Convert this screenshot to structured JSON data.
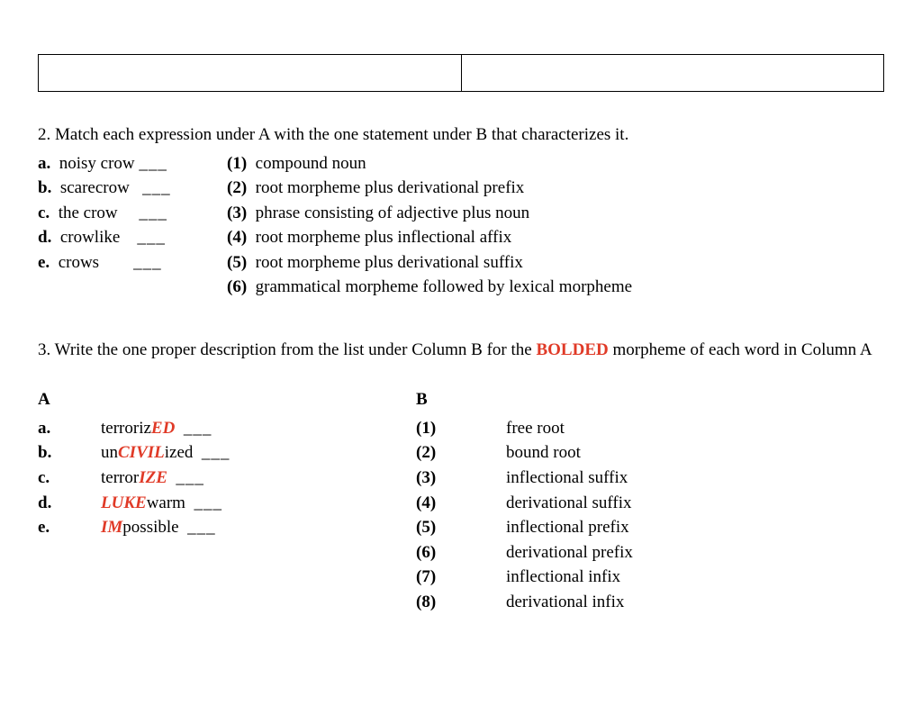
{
  "q2": {
    "prompt": "2. Match each expression under A with the one statement under B that characterizes it.",
    "leftItems": [
      {
        "marker": "a.",
        "text": "noisy crow"
      },
      {
        "marker": "b.",
        "text": "scarecrow"
      },
      {
        "marker": "c.",
        "text": "the crow"
      },
      {
        "marker": "d.",
        "text": "crowlike"
      },
      {
        "marker": "e.",
        "text": "crows"
      }
    ],
    "rightItems": [
      {
        "marker": "(1)",
        "text": "compound noun"
      },
      {
        "marker": "(2)",
        "text": "root morpheme plus derivational prefix"
      },
      {
        "marker": "(3)",
        "text": "phrase consisting of adjective plus noun"
      },
      {
        "marker": "(4)",
        "text": "root morpheme plus inflectional affix"
      },
      {
        "marker": "(5)",
        "text": "root morpheme plus derivational suffix"
      },
      {
        "marker": "(6)",
        "text": "grammatical morpheme followed by lexical morpheme"
      }
    ],
    "blank": "___"
  },
  "q3": {
    "prompt_pre": "3. Write the one proper description from the list under Column B for the ",
    "prompt_bold": "BOLDED",
    "prompt_post": " morpheme of each word in Column A",
    "colA_head": "A",
    "colB_head": "B",
    "A_items": [
      {
        "marker": "a.",
        "pre": "terroriz",
        "bold": "ED",
        "post": ""
      },
      {
        "marker": "b.",
        "pre": "un",
        "bold": "CIVIL",
        "post": "ized"
      },
      {
        "marker": "c.",
        "pre": "terror",
        "bold": "IZE",
        "post": ""
      },
      {
        "marker": "d.",
        "pre": "",
        "bold": "LUKE",
        "post": "warm"
      },
      {
        "marker": "e.",
        "pre": "",
        "bold": "IM",
        "post": "possible"
      }
    ],
    "B_items": [
      {
        "marker": "(1)",
        "text": "free root"
      },
      {
        "marker": "(2)",
        "text": "bound root"
      },
      {
        "marker": "(3)",
        "text": "inflectional suffix"
      },
      {
        "marker": "(4)",
        "text": "derivational suffix"
      },
      {
        "marker": "(5)",
        "text": "inflectional prefix"
      },
      {
        "marker": "(6)",
        "text": "derivational prefix"
      },
      {
        "marker": "(7)",
        "text": "inflectional infix"
      },
      {
        "marker": "(8)",
        "text": "derivational infix"
      }
    ],
    "blank": "___"
  }
}
